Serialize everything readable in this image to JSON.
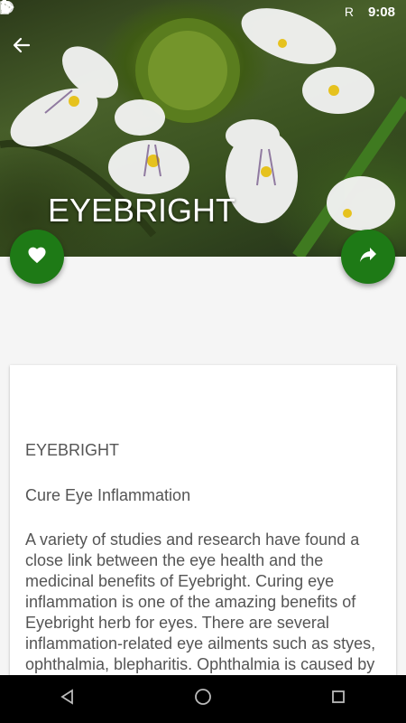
{
  "status_bar": {
    "time": "9:08",
    "carrier_indicator": "R"
  },
  "header": {
    "title": "EYEBRIGHT",
    "back_icon": "arrow-left-icon"
  },
  "actions": {
    "favorite_icon": "heart-icon",
    "share_icon": "share-icon"
  },
  "article": {
    "heading": "EYEBRIGHT",
    "subheading": "Cure Eye Inflammation",
    "body": "A variety of studies and research have found a close link between the eye health and the medicinal benefits of Eyebright. Curing eye inflammation is one of the amazing benefits of Eyebright herb for eyes. There are several inflammation-related eye ailments such as styes, ophthalmia, blepharitis. Ophthalmia is caused by the severe inflammation of the eye."
  },
  "colors": {
    "accent": "#1e7a16",
    "navbar": "#000000"
  }
}
